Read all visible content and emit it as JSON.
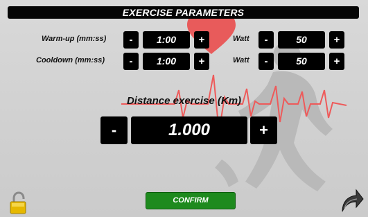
{
  "title": "EXERCISE PARAMETERS",
  "warmup": {
    "label": "Warm-up (mm:ss)",
    "minus": "-",
    "value": "1:00",
    "plus": "+"
  },
  "cooldown": {
    "label": "Cooldown (mm:ss)",
    "minus": "-",
    "value": "1:00",
    "plus": "+"
  },
  "warmup_watt": {
    "label": "Watt",
    "minus": "-",
    "value": "50",
    "plus": "+"
  },
  "cooldown_watt": {
    "label": "Watt",
    "minus": "-",
    "value": "50",
    "plus": "+"
  },
  "distance": {
    "label": "Distance exercise (Km)",
    "minus": "-",
    "value": "1.000",
    "plus": "+"
  },
  "confirm_label": "CONFIRM",
  "icons": {
    "lock": "padlock-icon",
    "back": "back-arrow-icon",
    "background": "runner-heart-ecg"
  },
  "colors": {
    "confirm": "#1e8a1e",
    "heart": "#e95050",
    "panel": "#000000"
  }
}
